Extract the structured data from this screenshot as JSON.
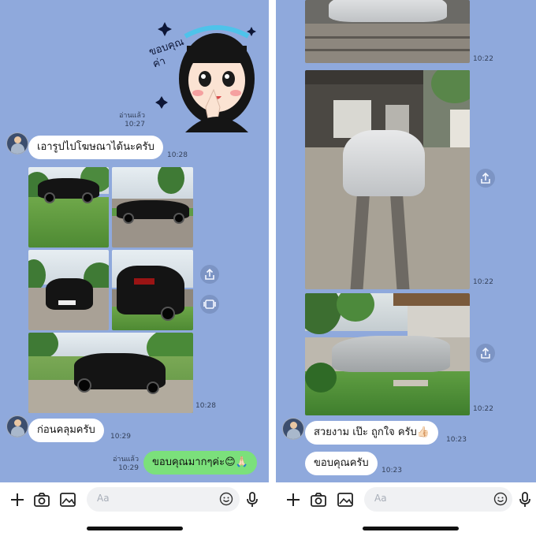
{
  "left": {
    "sticker": {
      "text": "ขอบคุณค่า"
    },
    "read_status_1": "อ่านแล้ว",
    "time_1": "10:27",
    "msg_1": {
      "text": "เอารูปไปโฆษณาได้นะครับ",
      "time": "10:28"
    },
    "photos_time": "10:28",
    "msg_2": {
      "text": "ก่อนคลุมครับ",
      "time": "10:29"
    },
    "read_status_2": "อ่านแล้ว",
    "time_2": "10:29",
    "msg_3": {
      "text": "ขอบคุณมากๆค่ะ😊🙏🏻"
    },
    "input": {
      "placeholder": "Aa"
    }
  },
  "right": {
    "photo_times": [
      "10:22",
      "10:22",
      "10:22"
    ],
    "msg_1": {
      "text": "สวยงาม เป๊ะ ถูกใจ ครับ👍🏻",
      "time": "10:23"
    },
    "msg_2": {
      "text": "ขอบคุณครับ",
      "time": "10:23"
    },
    "input": {
      "placeholder": "Aa"
    }
  },
  "icons": {
    "plus": "plus-icon",
    "camera": "camera-icon",
    "image": "image-icon",
    "emoji": "emoji-icon",
    "mic": "microphone-icon",
    "share": "share-icon",
    "gallery": "gallery-icon"
  },
  "colors": {
    "chat_background": "#8fa9dc",
    "incoming_bubble": "#ffffff",
    "outgoing_bubble": "#7be07b"
  }
}
